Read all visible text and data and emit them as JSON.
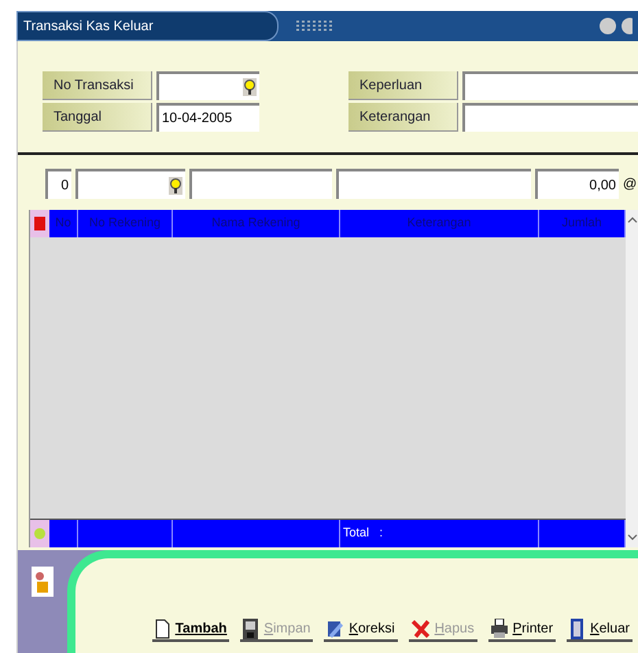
{
  "window": {
    "title": "Transaksi Kas Keluar"
  },
  "form": {
    "left": [
      {
        "label": "No Transaksi",
        "lookup": true
      },
      {
        "label": "Tanggal",
        "value": "10-04-2005",
        "lookup": false
      }
    ],
    "right": [
      {
        "label": "Keperluan"
      },
      {
        "label": "Keterangan"
      }
    ]
  },
  "entry": {
    "no": "0",
    "amount": "0,00",
    "at": "@"
  },
  "table": {
    "columns": [
      "No",
      "No Rekening",
      "Nama Rekening",
      "Keterangan",
      "Jumlah"
    ],
    "footer": {
      "label": "Total   :"
    }
  },
  "buttons": [
    {
      "label": "Tambah",
      "disabled": false,
      "default": true,
      "kind": "page"
    },
    {
      "label": "Simpan",
      "disabled": true,
      "default": false,
      "kind": "disk"
    },
    {
      "label": "Koreksi",
      "disabled": false,
      "default": false,
      "kind": "edit"
    },
    {
      "label": "Hapus",
      "disabled": true,
      "default": false,
      "kind": "cross"
    },
    {
      "label": "Printer",
      "disabled": false,
      "default": false,
      "kind": "printer"
    },
    {
      "label": "Keluar",
      "disabled": false,
      "default": false,
      "kind": "door"
    }
  ]
}
